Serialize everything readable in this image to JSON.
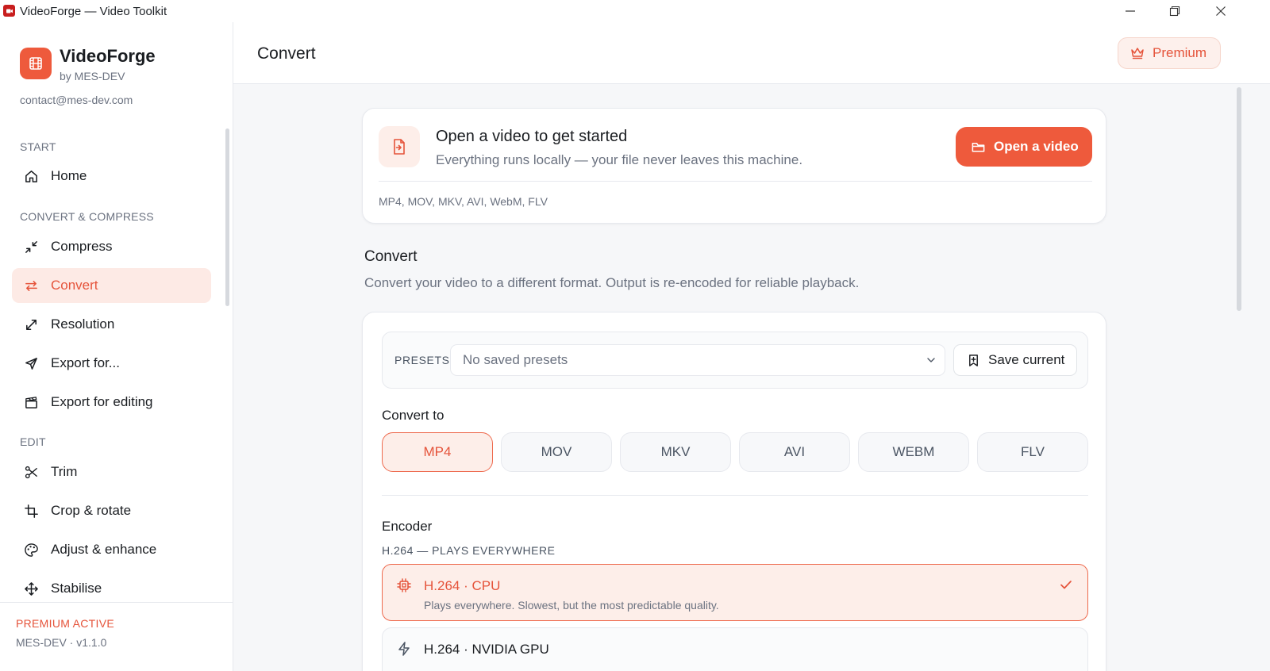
{
  "window": {
    "title": "VideoForge — Video Toolkit"
  },
  "brand": {
    "name": "VideoForge",
    "by": "by MES-DEV",
    "contact": "contact@mes-dev.com"
  },
  "sidebar": {
    "sections": [
      {
        "label": "START"
      },
      {
        "label": "CONVERT & COMPRESS"
      },
      {
        "label": "EDIT"
      }
    ],
    "items": [
      {
        "label": "Home",
        "icon": "home-icon"
      },
      {
        "label": "Compress",
        "icon": "compress-icon"
      },
      {
        "label": "Convert",
        "icon": "convert-icon",
        "active": true
      },
      {
        "label": "Resolution",
        "icon": "expand-icon"
      },
      {
        "label": "Export for...",
        "icon": "send-icon"
      },
      {
        "label": "Export for editing",
        "icon": "clapperboard-icon"
      },
      {
        "label": "Trim",
        "icon": "scissors-icon"
      },
      {
        "label": "Crop & rotate",
        "icon": "crop-icon"
      },
      {
        "label": "Adjust & enhance",
        "icon": "palette-icon"
      },
      {
        "label": "Stabilise",
        "icon": "move-icon"
      }
    ],
    "footer": {
      "status": "PREMIUM ACTIVE",
      "version": "MES-DEV · v1.1.0"
    }
  },
  "header": {
    "title": "Convert",
    "premium_label": "Premium"
  },
  "open_card": {
    "title": "Open a video to get started",
    "subtitle": "Everything runs locally — your file never leaves this machine.",
    "button_label": "Open a video",
    "formats": "MP4, MOV, MKV, AVI, WebM, FLV"
  },
  "convert": {
    "title": "Convert",
    "description": "Convert your video to a different format. Output is re-encoded for reliable playback.",
    "presets_label": "PRESETS",
    "presets_placeholder": "No saved presets",
    "save_label": "Save current",
    "convert_to_label": "Convert to",
    "formats": [
      "MP4",
      "MOV",
      "MKV",
      "AVI",
      "WEBM",
      "FLV"
    ],
    "selected_format": "MP4",
    "encoder_label": "Encoder",
    "encoder_group": "H.264 — PLAYS EVERYWHERE",
    "encoders": [
      {
        "name": "H.264 · CPU",
        "description": "Plays everywhere. Slowest, but the most predictable quality.",
        "selected": true,
        "icon": "cpu-icon"
      },
      {
        "name": "H.264 · NVIDIA GPU",
        "description": "",
        "selected": false,
        "icon": "lightning-icon"
      }
    ]
  },
  "colors": {
    "accent": "#ee5a3c",
    "accent_text": "#e5533a",
    "accent_soft": "#fdeee9"
  }
}
